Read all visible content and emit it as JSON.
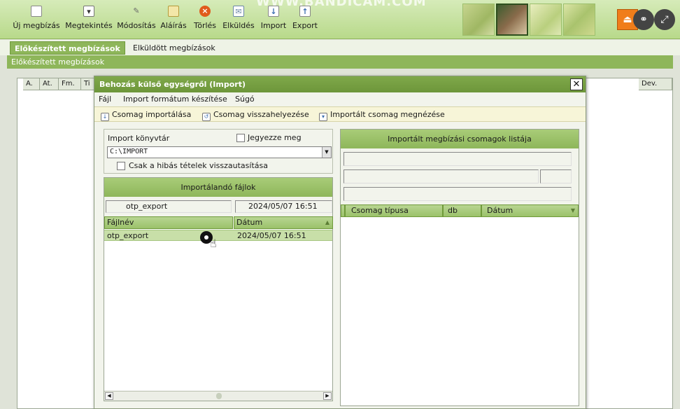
{
  "toolbar": {
    "buttons": [
      {
        "label": "Új megbízás",
        "icon": "new-document-icon"
      },
      {
        "label": "Megtekintés",
        "icon": "view-icon"
      },
      {
        "label": "Módosítás",
        "icon": "edit-icon"
      },
      {
        "label": "Aláírás",
        "icon": "sign-icon"
      },
      {
        "label": "Törlés",
        "icon": "delete-icon"
      },
      {
        "label": "Elküldés",
        "icon": "mail-icon"
      },
      {
        "label": "Import",
        "icon": "import-icon"
      },
      {
        "label": "Export",
        "icon": "export-icon"
      }
    ],
    "watermark": "WWW.BANDICAM.COM"
  },
  "tabs": {
    "active": "Előkészített megbízások",
    "inactive": "Elküldött megbízások"
  },
  "section_title": "Előkészített megbízások",
  "background_list": {
    "columns": [
      "A.",
      "At.",
      "Fm.",
      "Ti",
      "Dev."
    ]
  },
  "dialog": {
    "title": "Behozás külső egységről (Import)",
    "close_glyph": "✕",
    "menu": [
      "Fájl",
      "Import formátum készítése",
      "Súgó"
    ],
    "actions": [
      "Csomag importálása",
      "Csomag visszahelyezése",
      "Importált csomag megnézése"
    ],
    "import_dir_label": "Import könyvtár",
    "remember_label": "Jegyezze meg",
    "import_dir_value": "C:\\IMPORT",
    "reject_errors_label": "Csak a hibás tételek visszautasítása",
    "files_panel": {
      "title": "Importálandó fájlok",
      "filter_name": "otp_export",
      "filter_date": "2024/05/07 16:51",
      "columns": [
        "Fájlnév",
        "Dátum"
      ],
      "rows": [
        {
          "name": "otp_export",
          "date": "2024/05/07 16:51"
        }
      ]
    },
    "packages_panel": {
      "title": "Importált megbízási csomagok listája",
      "columns": [
        "Csomag típusa",
        "db",
        "Dátum"
      ]
    }
  },
  "colors": {
    "accent_green": "#8eb65a",
    "header_green": "#6d963a",
    "orange": "#f07d1a"
  }
}
